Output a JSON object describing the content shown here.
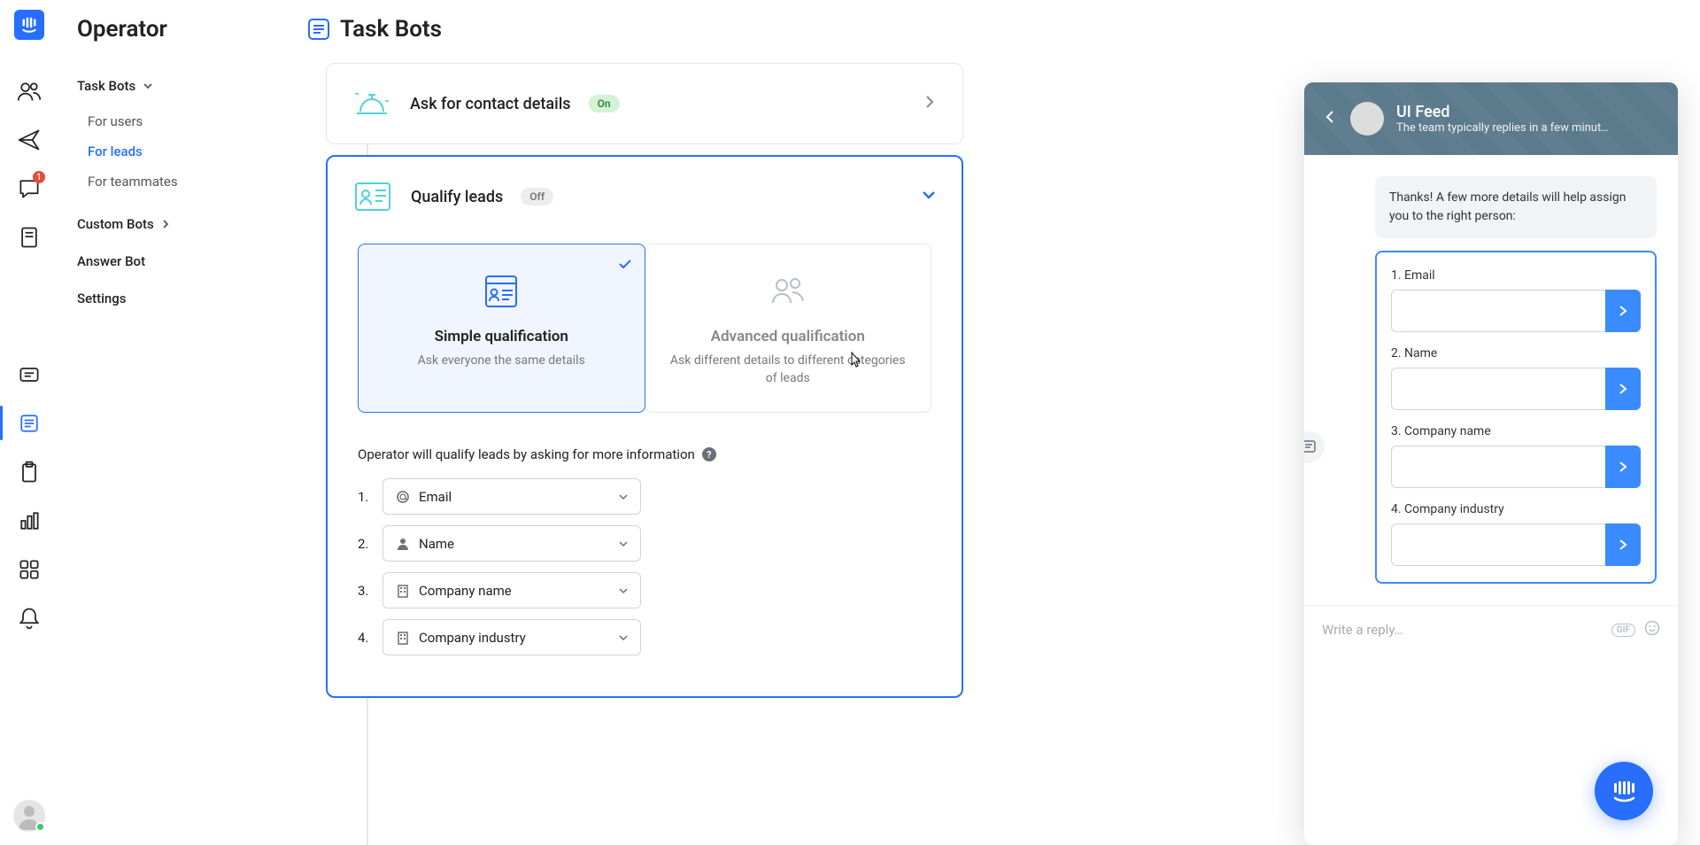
{
  "app": {
    "name": "Operator"
  },
  "rail": {
    "inbox_badge": "1"
  },
  "sidebar": {
    "title": "Operator",
    "nav_task_bots": "Task Bots",
    "sub_users": "For users",
    "sub_leads": "For leads",
    "sub_teammates": "For teammates",
    "nav_custom": "Custom Bots",
    "nav_answer": "Answer Bot",
    "nav_settings": "Settings"
  },
  "header": {
    "title": "Task Bots"
  },
  "card_contact": {
    "title": "Ask for contact details",
    "badge": "On"
  },
  "card_qualify": {
    "title": "Qualify leads",
    "badge": "Off",
    "simple_title": "Simple qualification",
    "simple_desc": "Ask everyone the same details",
    "adv_title": "Advanced qualification",
    "adv_desc": "Ask different details to different categories of leads",
    "section_label": "Operator will qualify leads by asking for more information",
    "fields": [
      {
        "num": "1.",
        "label": "Email"
      },
      {
        "num": "2.",
        "label": "Name"
      },
      {
        "num": "3.",
        "label": "Company name"
      },
      {
        "num": "4.",
        "label": "Company industry"
      }
    ]
  },
  "preview": {
    "title": "UI Feed",
    "subtitle": "The team typically replies in a few minut…",
    "msg": "Thanks! A few more details will help assign you to the right person:",
    "field1": "1. Email",
    "field2": "2. Name",
    "field3": "3. Company name",
    "field4": "4. Company industry",
    "reply_placeholder": "Write a reply…",
    "gif": "GIF"
  }
}
